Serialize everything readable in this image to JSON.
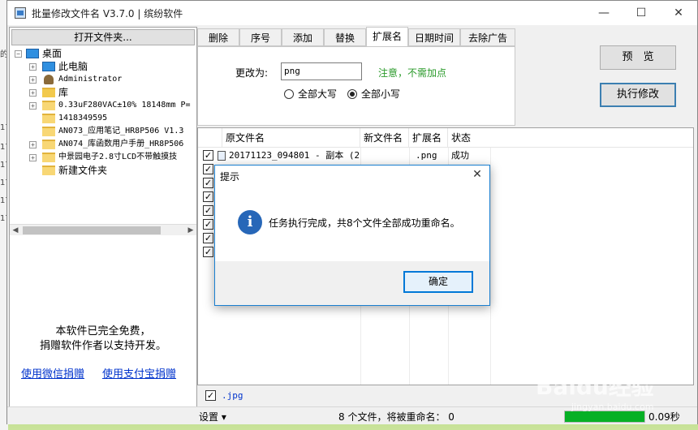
{
  "window": {
    "title": "批量修改文件名 V3.7.0 | 缤纷软件",
    "controls": {
      "minimize": "—",
      "maximize": "☐",
      "close": "✕"
    }
  },
  "left_panel": {
    "open_folder_button": "打开文件夹...",
    "tree": [
      {
        "label": "桌面",
        "icon": "desktop-icon"
      },
      {
        "label": "此电脑",
        "icon": "computer-icon"
      },
      {
        "label": "Administrator",
        "icon": "user-icon"
      },
      {
        "label": "库",
        "icon": "library-icon"
      },
      {
        "label": "0.33uF280VAC±10% 18148mm P=",
        "icon": "folder-icon"
      },
      {
        "label": "1418349595",
        "icon": "folder-icon"
      },
      {
        "label": "AN073_应用笔记_HR8P506 V1.3",
        "icon": "folder-icon"
      },
      {
        "label": "AN074_库函数用户手册_HR8P506",
        "icon": "folder-icon"
      },
      {
        "label": "中景园电子2.8寸LCD不带触摸技",
        "icon": "folder-icon"
      },
      {
        "label": "新建文件夹",
        "icon": "folder-icon"
      }
    ],
    "free_note_line1": "本软件已完全免费，",
    "free_note_line2": "捐赠软件作者以支持开发。",
    "donate_wechat": "使用微信捐赠",
    "donate_alipay": "使用支付宝捐赠"
  },
  "tabs": [
    "删除",
    "序号",
    "添加",
    "替换",
    "扩展名",
    "日期时间",
    "去除广告"
  ],
  "active_tab": "扩展名",
  "extension_tab": {
    "change_label": "更改为:",
    "input_value": "png",
    "notice": "注意，不需加点",
    "radio_upper": "全部大写",
    "radio_lower": "全部小写",
    "selected_radio": "全部小写"
  },
  "actions": {
    "preview": "预　览",
    "execute": "执行修改"
  },
  "file_list": {
    "columns": [
      "原文件名",
      "新文件名",
      "扩展名",
      "状态"
    ],
    "rows": [
      {
        "checked": true,
        "original": "20171123_094801 - 副本 (2)",
        "new_name": "",
        "ext": ".png",
        "status": "成功"
      },
      {
        "checked": true,
        "original": "",
        "new_name": "",
        "ext": "",
        "status": ""
      },
      {
        "checked": true,
        "original": "",
        "new_name": "",
        "ext": "",
        "status": ""
      },
      {
        "checked": true,
        "original": "",
        "new_name": "",
        "ext": "",
        "status": ""
      },
      {
        "checked": true,
        "original": "",
        "new_name": "",
        "ext": "",
        "status": ""
      },
      {
        "checked": true,
        "original": "",
        "new_name": "",
        "ext": "",
        "status": ""
      },
      {
        "checked": true,
        "original": "",
        "new_name": "",
        "ext": "",
        "status": ""
      },
      {
        "checked": true,
        "original": "",
        "new_name": "",
        "ext": "",
        "status": ""
      }
    ]
  },
  "filter": {
    "checked": true,
    "extension": ".jpg"
  },
  "status_bar": {
    "settings": "设置 ▾",
    "summary": "8 个文件，将被重命名： 0",
    "progress": 1.0,
    "elapsed": "0.09秒"
  },
  "dialog": {
    "title": "提示",
    "message": "任务执行完成，共8个文件全部成功重命名。",
    "ok_button": "确定",
    "icon": "info-icon"
  },
  "watermark": {
    "logo": "Baidu经验",
    "url": "jingyan.baidu.com"
  },
  "colors": {
    "accent": "#0078d7",
    "notice_green": "#2a9a2a",
    "progress_green": "#06b025",
    "link_blue": "#0033cc"
  }
}
